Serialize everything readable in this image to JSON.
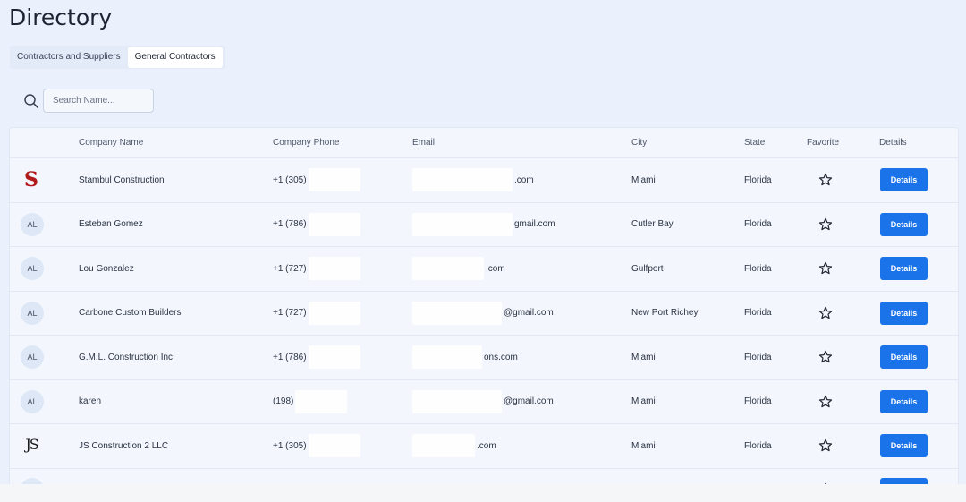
{
  "page": {
    "title": "Directory"
  },
  "tabs": [
    {
      "label": "Contractors and Suppliers",
      "active": false
    },
    {
      "label": "General Contractors",
      "active": true
    }
  ],
  "search": {
    "placeholder": "Search Name...",
    "value": ""
  },
  "table": {
    "columns": [
      "Company Name",
      "Company Phone",
      "Email",
      "City",
      "State",
      "Favorite",
      "Details"
    ],
    "details_label": "Details",
    "rows": [
      {
        "logo": "stambul-logo",
        "initials": "",
        "name": "Stambul Construction",
        "phone": "+1 (305)",
        "email_suffix": ".com",
        "city": "Miami",
        "state": "Florida",
        "favorite": false
      },
      {
        "logo": "",
        "initials": "AL",
        "name": "Esteban Gomez",
        "phone": "+1 (786)",
        "email_suffix": "gmail.com",
        "city": "Cutler Bay",
        "state": "Florida",
        "favorite": false
      },
      {
        "logo": "",
        "initials": "AL",
        "name": "Lou Gonzalez",
        "phone": "+1 (727)",
        "email_suffix": ".com",
        "city": "Gulfport",
        "state": "Florida",
        "favorite": false
      },
      {
        "logo": "",
        "initials": "AL",
        "name": "Carbone Custom Builders",
        "phone": "+1 (727)",
        "email_suffix": "@gmail.com",
        "city": "New Port Richey",
        "state": "Florida",
        "favorite": false
      },
      {
        "logo": "",
        "initials": "AL",
        "name": "G.M.L. Construction Inc",
        "phone": "+1 (786)",
        "email_suffix": "ons.com",
        "city": "Miami",
        "state": "Florida",
        "favorite": false
      },
      {
        "logo": "",
        "initials": "AL",
        "name": "karen",
        "phone": "(198)",
        "email_suffix": "@gmail.com",
        "city": "Miami",
        "state": "Florida",
        "favorite": false
      },
      {
        "logo": "js-logo",
        "initials": "",
        "name": "JS Construction 2 LLC",
        "phone": "+1 (305)",
        "email_suffix": ".com",
        "city": "Miami",
        "state": "Florida",
        "favorite": false
      }
    ]
  },
  "colors": {
    "accent": "#1a73e8",
    "background": "#eaf1fc",
    "logo_red": "#b01a1a"
  }
}
